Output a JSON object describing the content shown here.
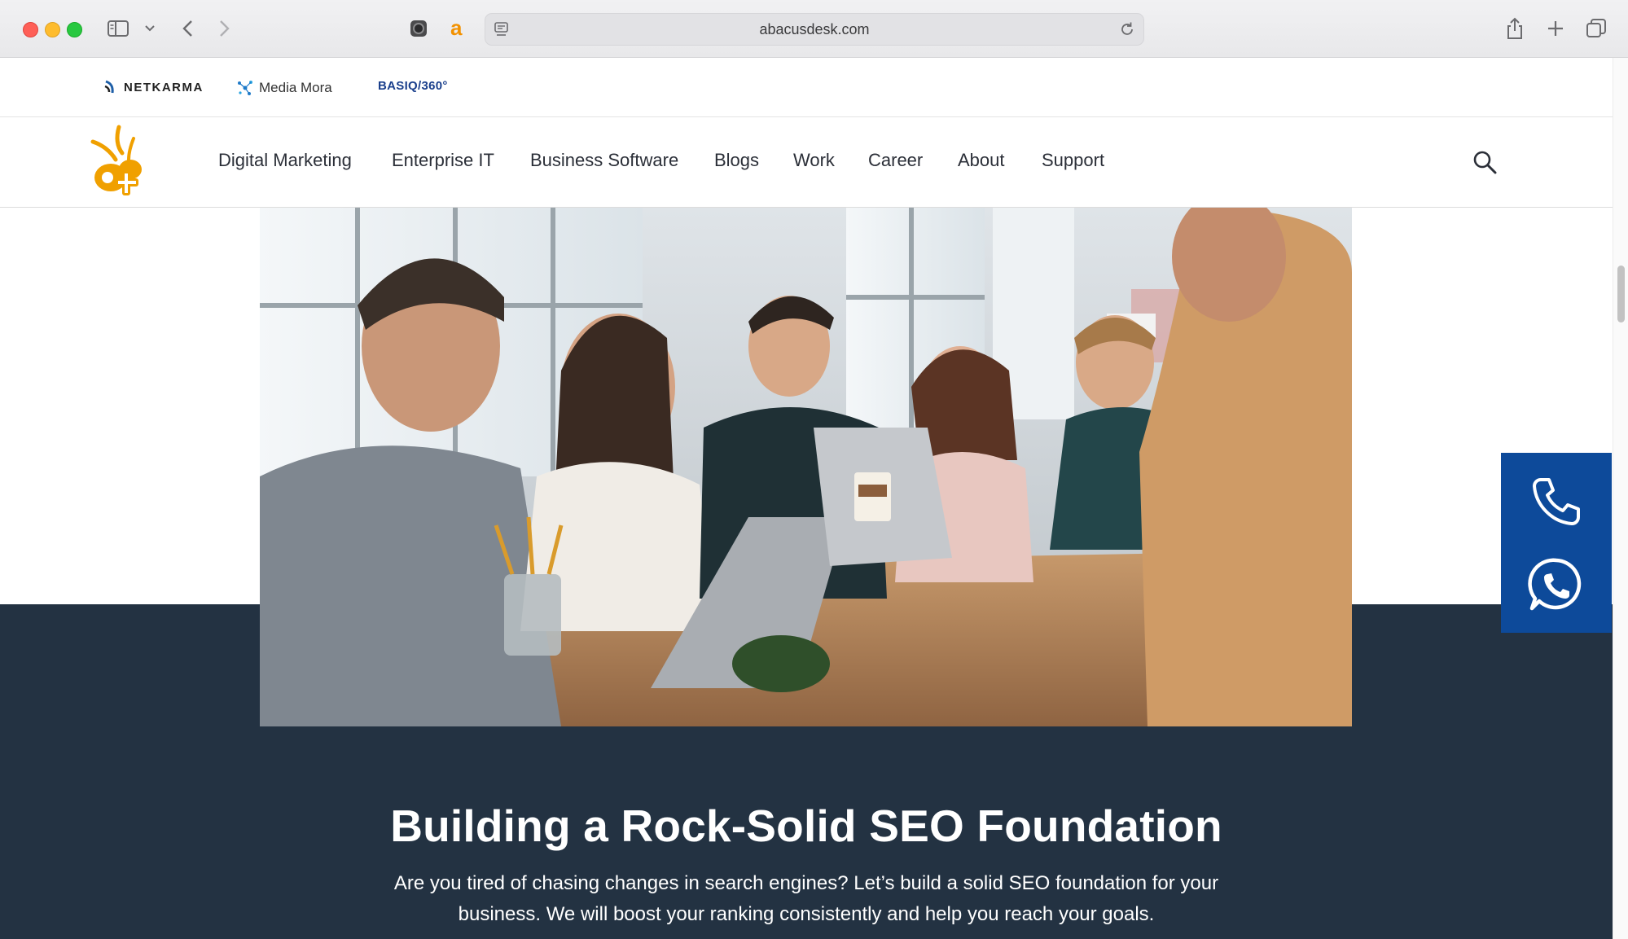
{
  "browser": {
    "url": "abacusdesk.com"
  },
  "partners": [
    {
      "name": "NETKARMA"
    },
    {
      "name": "Media Mora"
    },
    {
      "name": "BASIQ/360°"
    }
  ],
  "nav": {
    "items": [
      {
        "label": "Digital Marketing"
      },
      {
        "label": "Enterprise IT"
      },
      {
        "label": "Business Software"
      },
      {
        "label": "Blogs"
      },
      {
        "label": "Work"
      },
      {
        "label": "Career"
      },
      {
        "label": "About"
      },
      {
        "label": "Support"
      }
    ]
  },
  "hero": {
    "headline": "Building a Rock-Solid SEO Foundation",
    "subtext": "Are you tired of chasing changes in search engines? Let’s build a solid SEO foundation for your business. We will boost your ranking consistently and help you reach your goals."
  },
  "colors": {
    "brand_orange": "#f0a000",
    "dark_band": "#233242",
    "contact_blue": "#0d4a9a"
  }
}
